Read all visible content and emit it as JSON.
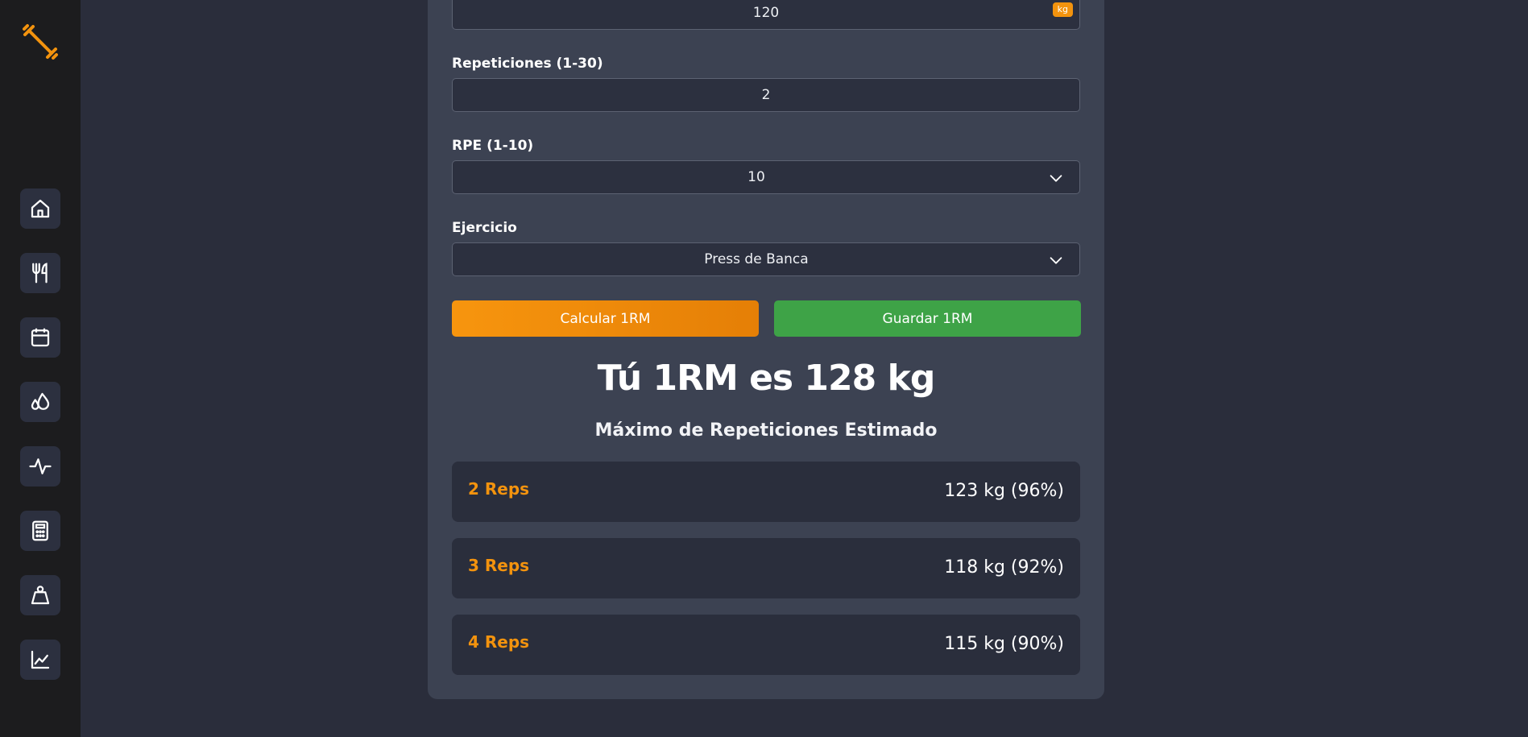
{
  "colors": {
    "accent": "#f3930e",
    "save_green": "#3ea347",
    "background": "#2a2d3b",
    "card": "#3c4252",
    "sidebar": "#1c1c1e"
  },
  "sidebar": {
    "logo_icon": "dumbbell-icon",
    "items": [
      {
        "icon": "home-icon"
      },
      {
        "icon": "utensils-icon"
      },
      {
        "icon": "calendar-icon"
      },
      {
        "icon": "droplets-icon"
      },
      {
        "icon": "activity-icon"
      },
      {
        "icon": "calculator-icon"
      },
      {
        "icon": "weight-icon"
      },
      {
        "icon": "line-chart-icon"
      }
    ]
  },
  "form": {
    "weight_value": "120",
    "weight_unit": "kg",
    "reps_label": "Repeticiones (1-30)",
    "reps_value": "2",
    "rpe_label": "RPE (1-10)",
    "rpe_value": "10",
    "exercise_label": "Ejercicio",
    "exercise_value": "Press de Banca",
    "calc_button": "Calcular 1RM",
    "save_button": "Guardar 1RM"
  },
  "result": {
    "headline": "Tú 1RM es 128 kg",
    "subtitle": "Máximo de Repeticiones Estimado",
    "rows": [
      {
        "reps": "2 Reps",
        "value": "123 kg (96%)"
      },
      {
        "reps": "3 Reps",
        "value": "118 kg (92%)"
      },
      {
        "reps": "4 Reps",
        "value": "115 kg (90%)"
      }
    ]
  }
}
